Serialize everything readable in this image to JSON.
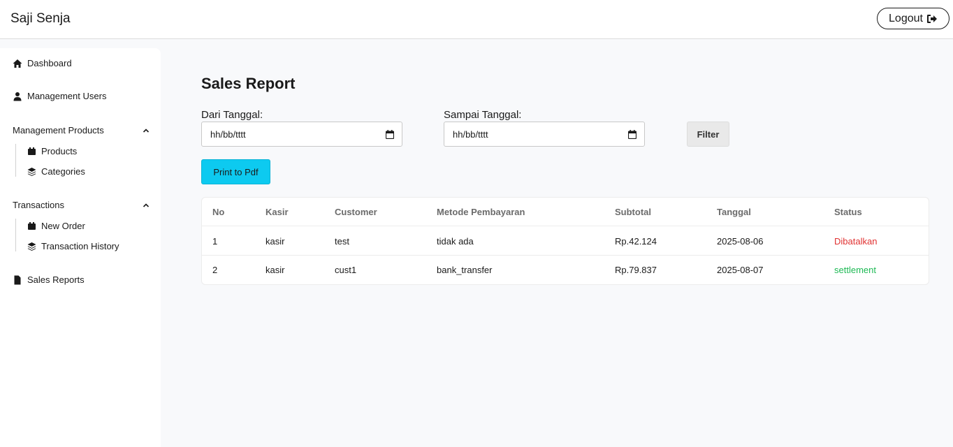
{
  "app": {
    "brand": "Saji Senja",
    "logout_label": "Logout"
  },
  "sidebar": {
    "dashboard": "Dashboard",
    "users": "Management Users",
    "products_group": "Management Products",
    "products": "Products",
    "categories": "Categories",
    "transactions_group": "Transactions",
    "new_order": "New Order",
    "history": "Transaction History",
    "sales_reports": "Sales Reports"
  },
  "page": {
    "title": "Sales Report",
    "from_label": "Dari Tanggal:",
    "to_label": "Sampai Tanggal:",
    "from_value": "hh/bb/tttt",
    "to_value": "hh/bb/tttt",
    "filter_label": "Filter",
    "print_label": "Print to Pdf"
  },
  "table": {
    "headers": [
      "No",
      "Kasir",
      "Customer",
      "Metode Pembayaran",
      "Subtotal",
      "Tanggal",
      "Status"
    ],
    "rows": [
      [
        "1",
        "kasir",
        "test",
        "tidak ada",
        "Rp.42.124",
        "2025-08-06",
        "Dibatalkan"
      ],
      [
        "2",
        "kasir",
        "cust1",
        "bank_transfer",
        "Rp.79.837",
        "2025-08-07",
        "settlement"
      ]
    ]
  },
  "colors": {
    "cancelled": "#e03131",
    "settlement": "#1db954",
    "print_button": "#0dcaf0"
  }
}
